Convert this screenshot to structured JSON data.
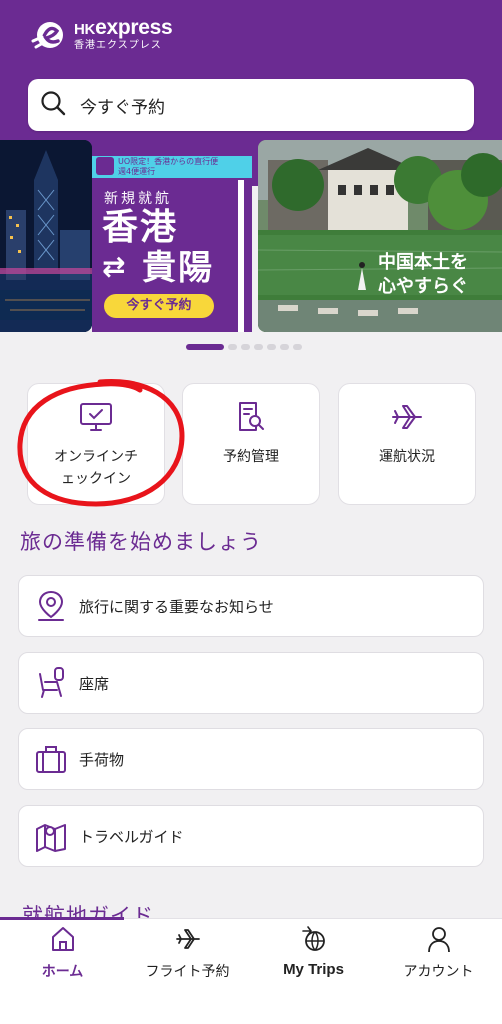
{
  "header": {
    "logo_main": "express",
    "logo_hk": "HK",
    "logo_sub": "香港エクスプレス"
  },
  "search": {
    "placeholder": "今すぐ予約"
  },
  "banner": {
    "promo_tag_line1": "UO限定！香港からの直行便",
    "promo_tag_line2": "週4便運行",
    "new_route": "新規就航",
    "city_from": "香港",
    "city_to": "貴陽",
    "cta": "今すぐ予約",
    "right_caption_1": "中国本土を",
    "right_caption_2": "心やすらぐ",
    "slide_count": 7,
    "active_slide": 1
  },
  "quick_actions": [
    {
      "label": "オンラインチ\nェックイン",
      "icon": "monitor-check-icon"
    },
    {
      "label": "予約管理",
      "icon": "document-search-icon"
    },
    {
      "label": "運航状況",
      "icon": "plane-icon"
    }
  ],
  "section_title": "旅の準備を始めましょう",
  "list": [
    {
      "label": "旅行に関する重要なお知らせ",
      "icon": "location-pin-icon"
    },
    {
      "label": "座席",
      "icon": "seat-icon"
    },
    {
      "label": "手荷物",
      "icon": "luggage-icon"
    },
    {
      "label": "トラベルガイド",
      "icon": "map-pin-icon"
    }
  ],
  "section_title_2": "就航地ガイド",
  "tabs": [
    {
      "label": "ホーム",
      "icon": "home-icon",
      "active": true
    },
    {
      "label": "フライト予約",
      "icon": "plane-icon"
    },
    {
      "label": "My Trips",
      "icon": "globe-plane-icon"
    },
    {
      "label": "アカウント",
      "icon": "user-icon"
    }
  ],
  "colors": {
    "brand": "#6b2b92",
    "background": "#f1f0f2",
    "annotation": "#e8141b"
  }
}
